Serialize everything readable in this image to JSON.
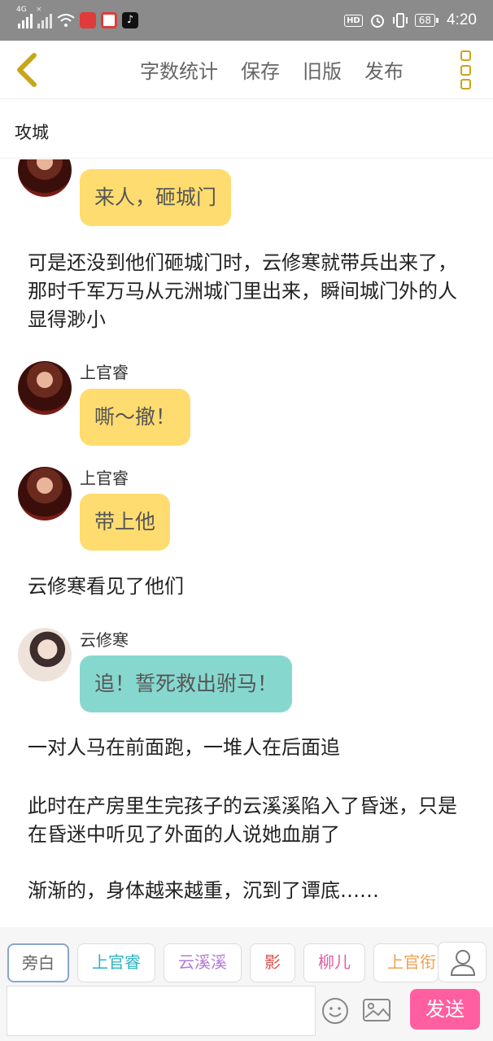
{
  "status_bar": {
    "network_labels": [
      "4G",
      "×"
    ],
    "hd_label": "HD",
    "battery": "68",
    "time": "4:20",
    "icons": [
      "signal-icon",
      "wifi-icon",
      "app-love-icon",
      "app-red-icon",
      "tiktok-icon",
      "alarm-icon",
      "vibrate-icon"
    ]
  },
  "nav": {
    "back_icon": "chevron-left-icon",
    "actions": [
      "字数统计",
      "保存",
      "旧版",
      "发布"
    ],
    "more_icon": "more-vertical-icon"
  },
  "title": "攻城",
  "messages": [
    {
      "type": "bubble",
      "speaker": "",
      "text": "来人，砸城门",
      "color": "#fedc6f",
      "avatar": "red"
    },
    {
      "type": "narration",
      "text": "可是还没到他们砸城门时，云修寒就带兵出来了，那时千军万马从元洲城门里出来，瞬间城门外的人显得渺小"
    },
    {
      "type": "bubble",
      "speaker": "上官睿",
      "text": "嘶～撤！",
      "color": "#fedc6f",
      "avatar": "red"
    },
    {
      "type": "bubble",
      "speaker": "上官睿",
      "text": "带上他",
      "color": "#fedc6f",
      "avatar": "red"
    },
    {
      "type": "narration",
      "text": "云修寒看见了他们"
    },
    {
      "type": "bubble",
      "speaker": "云修寒",
      "text": "追！誓死救出驸马！",
      "color": "#86d8cf",
      "avatar": "light"
    },
    {
      "type": "narration",
      "text": "一对人马在前面跑，一堆人在后面追"
    },
    {
      "type": "narration",
      "text": "此时在产房里生完孩子的云溪溪陷入了昏迷，只是在昏迷中听见了外面的人说她血崩了"
    },
    {
      "type": "narration",
      "text": "渐渐的，身体越来越重，沉到了谭底……"
    }
  ],
  "roles": [
    {
      "label": "旁白",
      "color": "#666666",
      "active": true
    },
    {
      "label": "上官睿",
      "color": "#2bb3c0",
      "active": false
    },
    {
      "label": "云溪溪",
      "color": "#b57ad6",
      "active": false
    },
    {
      "label": "影",
      "color": "#d9534f",
      "active": false
    },
    {
      "label": "柳儿",
      "color": "#e25ca0",
      "active": false
    },
    {
      "label": "上官衔",
      "color": "#f0a050",
      "active": false
    }
  ],
  "user_icon": "user-icon",
  "input": {
    "value": "",
    "placeholder": ""
  },
  "emoji_icon": "smiley-icon",
  "image_icon": "image-icon",
  "send_label": "发送"
}
